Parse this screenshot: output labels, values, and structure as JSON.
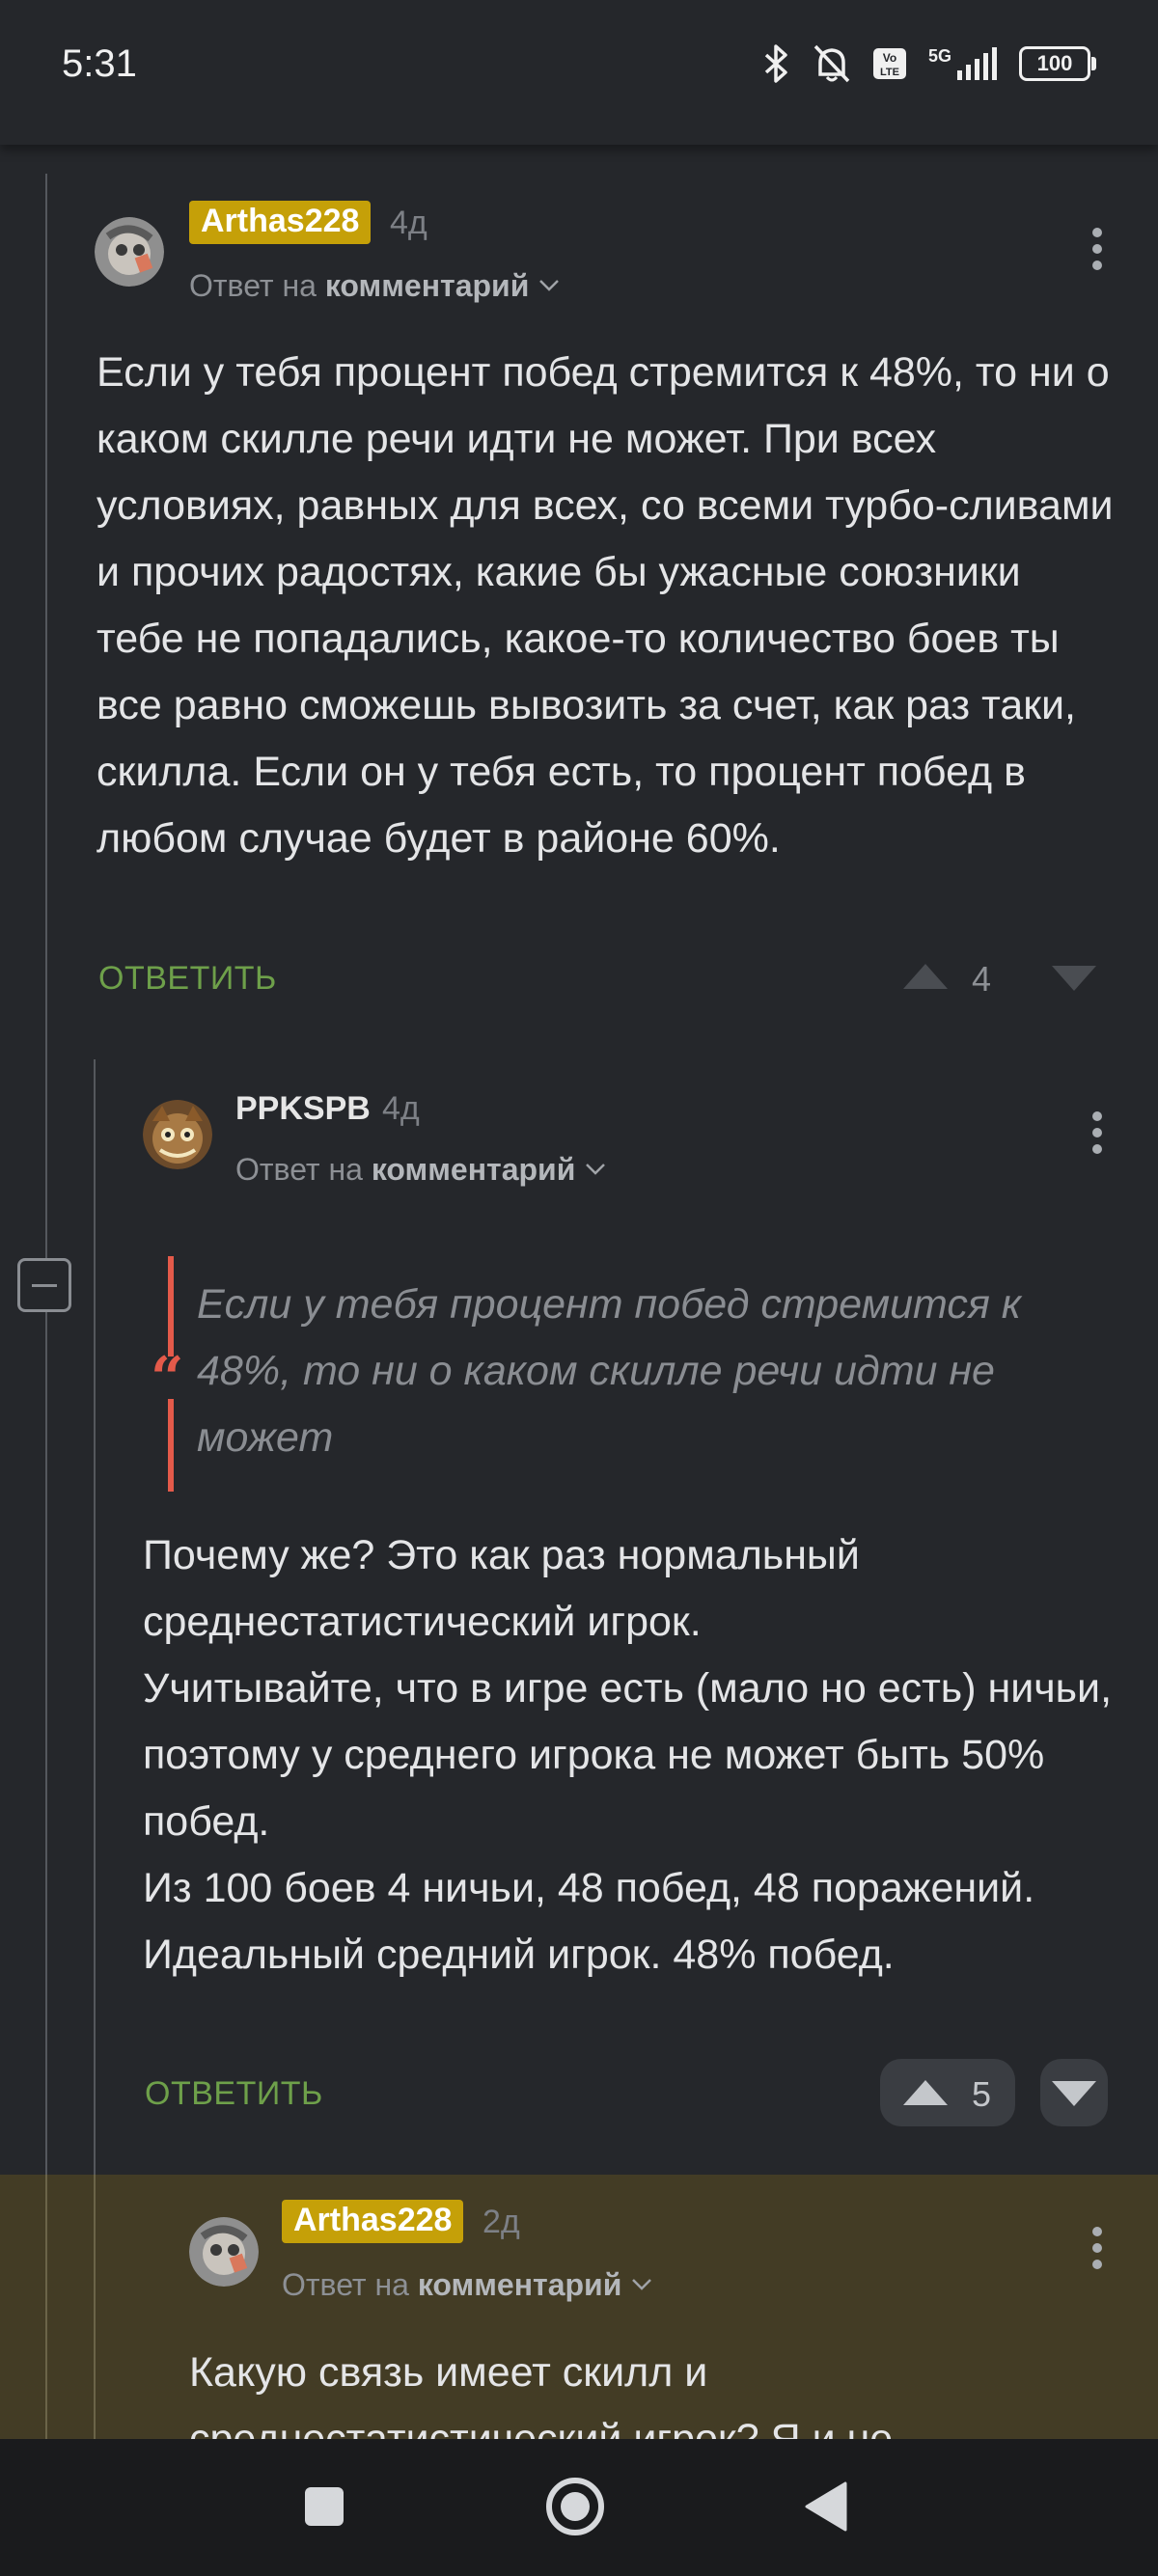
{
  "status_bar": {
    "time": "5:31",
    "icons": [
      "bluetooth-icon",
      "bell-off-icon",
      "volte-icon",
      "signal-5g-icon"
    ],
    "volte_label": "Vo\nLTE",
    "network": "5G",
    "battery": "100"
  },
  "comments": [
    {
      "author": "Arthas228",
      "age": "4д",
      "reply_prefix": "Ответ на",
      "reply_target": "комментарий",
      "paragraphs": [
        "Если у тебя процент побед стремится к 48%, то ни о каком скилле речи идти не может. При всех условиях, равных для всех, со всеми турбо-сливами и прочих радостях, какие бы ужасные союзники тебе не попадались, какое-то количество боев ты все равно сможешь вывозить за счет, как раз таки, скилла. Если он у тебя есть, то процент побед в любом случае будет в районе 60%."
      ],
      "reply_label": "ОТВЕТИТЬ",
      "votes": "4"
    },
    {
      "author": "PPKSPB",
      "age": "4д",
      "reply_prefix": "Ответ на",
      "reply_target": "комментарий",
      "quote": "Если у тебя процент побед стремится к 48%, то ни о каком скилле речи идти не может",
      "paragraphs": [
        "Почему же? Это как раз нормальный среднестатистический игрок.",
        "Учитывайте, что в игре есть (мало но есть) ничьи, поэтому у среднего игрока не может быть 50% побед.",
        "Из 100 боев 4 ничьи, 48 побед, 48 поражений. Идеальный средний игрок. 48% побед."
      ],
      "reply_label": "ОТВЕТИТЬ",
      "votes": "5"
    },
    {
      "author": "Arthas228",
      "age": "2д",
      "reply_prefix": "Ответ на",
      "reply_target": "комментарий",
      "paragraphs": [
        "Какую связь имеет скилл и среднестатистический игрок? Я и не"
      ]
    }
  ],
  "colors": {
    "background": "#25272b",
    "badge": "#c5a008",
    "reply_link": "#6ea04a",
    "quote_accent": "#e45a4a",
    "highlight": "#433c25"
  },
  "nav_bar": {
    "buttons": [
      "recents-square-icon",
      "home-circle-icon",
      "back-triangle-icon"
    ]
  }
}
